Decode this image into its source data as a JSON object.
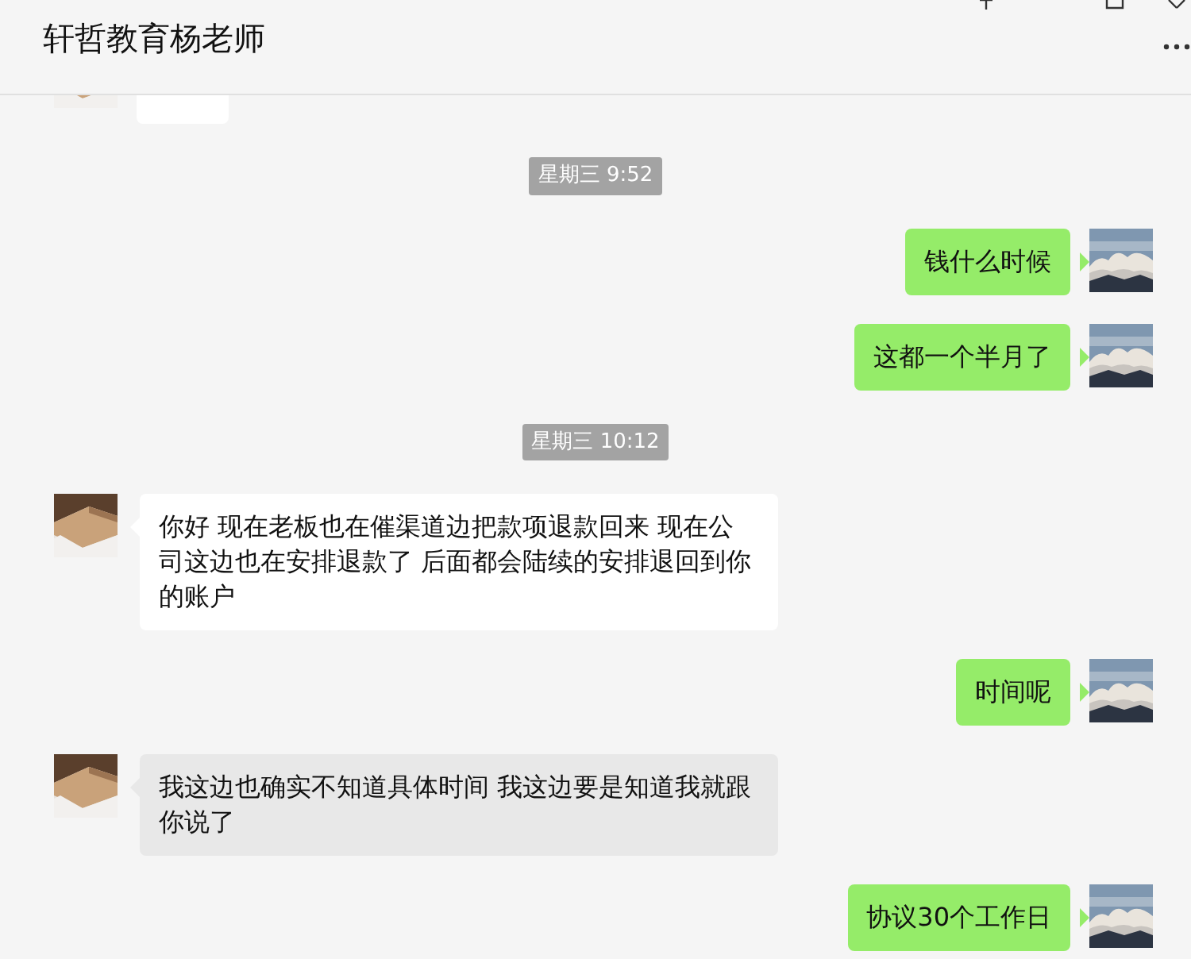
{
  "window": {
    "title": "轩哲教育杨老师"
  },
  "messages": [
    {
      "kind": "cut"
    },
    {
      "kind": "time",
      "text": "星期三 9:52"
    },
    {
      "kind": "sent",
      "text": "钱什么时候"
    },
    {
      "kind": "sent",
      "text": "这都一个半月了"
    },
    {
      "kind": "time",
      "text": "星期三 10:12"
    },
    {
      "kind": "received",
      "text": "你好  现在老板也在催渠道边把款项退款回来  现在公司这边也在安排退款了  后面都会陆续的安排退回到你的账户",
      "highlighted": false
    },
    {
      "kind": "sent",
      "text": "时间呢"
    },
    {
      "kind": "received",
      "text": "我这边也确实不知道具体时间  我这边要是知道我就跟你说了",
      "highlighted": true
    },
    {
      "kind": "sent",
      "text": "协议30个工作日"
    }
  ]
}
